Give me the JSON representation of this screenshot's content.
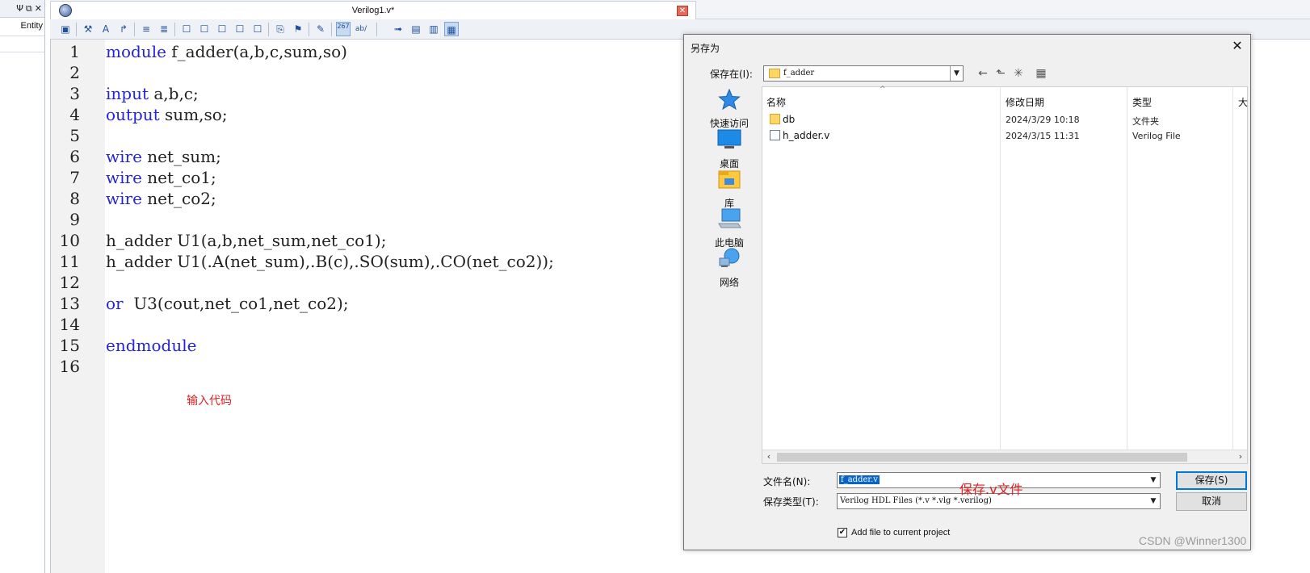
{
  "left_panel": {
    "bar_icons": [
      "Ψ",
      "⧉",
      "✕"
    ],
    "entity_label": "Entity"
  },
  "editor": {
    "tab_title": "Verilog1.v*",
    "tab_close": "✕",
    "line_numbers": [
      "1",
      "2",
      "3",
      "4",
      "5",
      "6",
      "7",
      "8",
      "9",
      "10",
      "11",
      "12",
      "13",
      "14",
      "15",
      "16"
    ],
    "code": [
      {
        "kw": "module",
        "rest": " f_adder(a,b,c,sum,so)"
      },
      {
        "kw": "",
        "rest": ""
      },
      {
        "kw": "input",
        "rest": " a,b,c;"
      },
      {
        "kw": "output",
        "rest": " sum,so;"
      },
      {
        "kw": "",
        "rest": ""
      },
      {
        "kw": "wire",
        "rest": " net_sum;"
      },
      {
        "kw": "wire",
        "rest": " net_co1;"
      },
      {
        "kw": "wire",
        "rest": " net_co2;"
      },
      {
        "kw": "",
        "rest": ""
      },
      {
        "kw": "",
        "rest": "h_adder U1(a,b,net_sum,net_co1);"
      },
      {
        "kw": "",
        "rest": "h_adder U1(.A(net_sum),.B(c),.SO(sum),.CO(net_co2));"
      },
      {
        "kw": "",
        "rest": ""
      },
      {
        "kw": "or",
        "rest": "  U3(cout,net_co1,net_co2);"
      },
      {
        "kw": "",
        "rest": ""
      },
      {
        "kw": "endmodule",
        "rest": ""
      },
      {
        "kw": "",
        "rest": ""
      }
    ],
    "keyword_color": "#2424dd"
  },
  "toolbar": {
    "icons": [
      "▣",
      "⚒",
      "A",
      "↱",
      "≡",
      "≣",
      "☐",
      "☐",
      "☐",
      "☐",
      "☐",
      "⎘",
      "⚑",
      "✎",
      "267",
      "ab/",
      "➟",
      "▤",
      "▥",
      "▦"
    ]
  },
  "annotations": {
    "code_note": "输入代码",
    "save_note": "保存.v文件",
    "annotation_color": "#e02020"
  },
  "dialog": {
    "title": "另存为",
    "close": "✕",
    "save_in_label": "保存在(I):",
    "save_in_value": "f_adder",
    "nav_icons": [
      "←",
      "⬑",
      "✳",
      "▦"
    ],
    "places": [
      {
        "label": "快速访问"
      },
      {
        "label": "桌面"
      },
      {
        "label": "库"
      },
      {
        "label": "此电脑"
      },
      {
        "label": "网络"
      }
    ],
    "columns": {
      "name": "名称",
      "date": "修改日期",
      "type": "类型",
      "size": "大"
    },
    "files": [
      {
        "name": "db",
        "date": "2024/3/29 10:18",
        "type": "文件夹"
      },
      {
        "name": "h_adder.v",
        "date": "2024/3/15 11:31",
        "type": "Verilog File"
      }
    ],
    "scroll_left": "‹",
    "scroll_right": "›",
    "filename_label": "文件名(N):",
    "filename_value": "f_adder.v",
    "filetype_label": "保存类型(T):",
    "filetype_value": "Verilog HDL Files (*.v *.vlg *.verilog)",
    "save_button": "保存(S)",
    "cancel_button": "取消",
    "add_to_project_checked": true,
    "add_to_project_label": "Add file to current project",
    "dropdown_arrow": "▼",
    "check_mark": "✔"
  },
  "watermark": "CSDN @Winner1300"
}
